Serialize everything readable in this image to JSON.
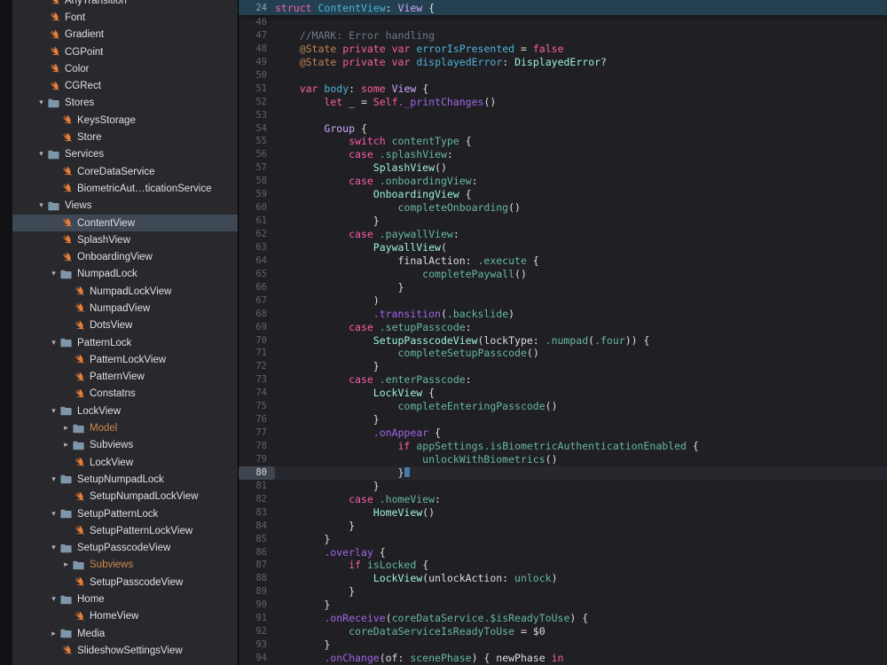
{
  "ui_colors": {
    "sidebar_bg": "#28282d",
    "editor_bg": "#1f1f24",
    "selection_bg": "#3f4855",
    "sticky_header_bg": "#234050",
    "gutter_text": "#60646d",
    "swift_icon": "#e87f38",
    "folder_icon": "#7e96aa",
    "modified_item": "#cc8a4d"
  },
  "sidebar": {
    "selected_label": "ContentView",
    "items": [
      {
        "label": "AnyTransition",
        "icon": "swift",
        "level": 1
      },
      {
        "label": "Font",
        "icon": "swift",
        "level": 1
      },
      {
        "label": "Gradient",
        "icon": "swift",
        "level": 1
      },
      {
        "label": "CGPoint",
        "icon": "swift",
        "level": 1
      },
      {
        "label": "Color",
        "icon": "swift",
        "level": 1
      },
      {
        "label": "CGRect",
        "icon": "swift",
        "level": 1
      },
      {
        "label": "Stores",
        "icon": "folder-open",
        "level": 1
      },
      {
        "label": "KeysStorage",
        "icon": "swift",
        "level": 2
      },
      {
        "label": "Store",
        "icon": "swift",
        "level": 2
      },
      {
        "label": "Services",
        "icon": "folder-open",
        "level": 1
      },
      {
        "label": "CoreDataService",
        "icon": "swift",
        "level": 2
      },
      {
        "label": "BiometricAut…ticationService",
        "icon": "swift",
        "level": 2
      },
      {
        "label": "Views",
        "icon": "folder-open",
        "level": 1
      },
      {
        "label": "ContentView",
        "icon": "swift",
        "level": 2,
        "selected": true
      },
      {
        "label": "SplashView",
        "icon": "swift",
        "level": 2
      },
      {
        "label": "OnboardingView",
        "icon": "swift",
        "level": 2
      },
      {
        "label": "NumpadLock",
        "icon": "folder-open",
        "level": 2
      },
      {
        "label": "NumpadLockView",
        "icon": "swift",
        "level": 3
      },
      {
        "label": "NumpadView",
        "icon": "swift",
        "level": 3
      },
      {
        "label": "DotsView",
        "icon": "swift",
        "level": 3
      },
      {
        "label": "PatternLock",
        "icon": "folder-open",
        "level": 2
      },
      {
        "label": "PatternLockView",
        "icon": "swift",
        "level": 3
      },
      {
        "label": "PatternView",
        "icon": "swift",
        "level": 3
      },
      {
        "label": "Constatns",
        "icon": "swift",
        "level": 3
      },
      {
        "label": "LockView",
        "icon": "folder-open",
        "level": 2
      },
      {
        "label": "Model",
        "icon": "folder-closed",
        "level": 3,
        "color": "#cc8a4d"
      },
      {
        "label": "Subviews",
        "icon": "folder-closed",
        "level": 3
      },
      {
        "label": "LockView",
        "icon": "swift",
        "level": 3
      },
      {
        "label": "SetupNumpadLock",
        "icon": "folder-open",
        "level": 2
      },
      {
        "label": "SetupNumpadLockView",
        "icon": "swift",
        "level": 3
      },
      {
        "label": "SetupPatternLock",
        "icon": "folder-open",
        "level": 2
      },
      {
        "label": "SetupPatternLockView",
        "icon": "swift",
        "level": 3
      },
      {
        "label": "SetupPasscodeView",
        "icon": "folder-open",
        "level": 2
      },
      {
        "label": "Subviews",
        "icon": "folder-closed",
        "level": 3,
        "color": "#cc8a4d"
      },
      {
        "label": "SetupPasscodeView",
        "icon": "swift",
        "level": 3
      },
      {
        "label": "Home",
        "icon": "folder-open",
        "level": 2
      },
      {
        "label": "HomeView",
        "icon": "swift",
        "level": 3
      },
      {
        "label": "Media",
        "icon": "folder-closed",
        "level": 2
      },
      {
        "label": "SlideshowSettingsView",
        "icon": "swift",
        "level": 2
      }
    ]
  },
  "editor": {
    "palette": {
      "p": "#dfdfe0",
      "k": "#fc5fa3",
      "a": "#bf8555",
      "tp": "#9ef1dd",
      "mp": "#67b7a4",
      "to": "#d0a8ff",
      "mo": "#a167e6",
      "c": "#6c7986",
      "d": "#4fb4d8"
    },
    "sticky": {
      "number": "24",
      "tokens": [
        [
          "k",
          "struct"
        ],
        [
          "p",
          " "
        ],
        [
          "d",
          "ContentView"
        ],
        [
          "p",
          ": "
        ],
        [
          "to",
          "View"
        ],
        [
          "p",
          " {"
        ]
      ]
    },
    "current_line": "80",
    "lines": [
      {
        "number": "46",
        "tokens": []
      },
      {
        "number": "47",
        "tokens": [
          [
            "c",
            "    //MARK: Error handling"
          ]
        ]
      },
      {
        "number": "48",
        "tokens": [
          [
            "p",
            "    "
          ],
          [
            "a",
            "@State"
          ],
          [
            "p",
            " "
          ],
          [
            "k",
            "private"
          ],
          [
            "p",
            " "
          ],
          [
            "k",
            "var"
          ],
          [
            "p",
            " "
          ],
          [
            "d",
            "errorIsPresented"
          ],
          [
            "p",
            " = "
          ],
          [
            "k",
            "false"
          ]
        ]
      },
      {
        "number": "49",
        "tokens": [
          [
            "p",
            "    "
          ],
          [
            "a",
            "@State"
          ],
          [
            "p",
            " "
          ],
          [
            "k",
            "private"
          ],
          [
            "p",
            " "
          ],
          [
            "k",
            "var"
          ],
          [
            "p",
            " "
          ],
          [
            "d",
            "displayedError"
          ],
          [
            "p",
            ": "
          ],
          [
            "tp",
            "DisplayedError"
          ],
          [
            "p",
            "?"
          ]
        ]
      },
      {
        "number": "50",
        "tokens": []
      },
      {
        "number": "51",
        "tokens": [
          [
            "p",
            "    "
          ],
          [
            "k",
            "var"
          ],
          [
            "p",
            " "
          ],
          [
            "d",
            "body"
          ],
          [
            "p",
            ": "
          ],
          [
            "k",
            "some"
          ],
          [
            "p",
            " "
          ],
          [
            "to",
            "View"
          ],
          [
            "p",
            " {"
          ]
        ]
      },
      {
        "number": "52",
        "tokens": [
          [
            "p",
            "        "
          ],
          [
            "k",
            "let"
          ],
          [
            "p",
            " _ = "
          ],
          [
            "k",
            "Self"
          ],
          [
            "mo",
            "._printChanges"
          ],
          [
            "p",
            "()"
          ]
        ]
      },
      {
        "number": "53",
        "tokens": []
      },
      {
        "number": "54",
        "tokens": [
          [
            "p",
            "        "
          ],
          [
            "to",
            "Group"
          ],
          [
            "p",
            " {"
          ]
        ]
      },
      {
        "number": "55",
        "tokens": [
          [
            "p",
            "            "
          ],
          [
            "k",
            "switch"
          ],
          [
            "p",
            " "
          ],
          [
            "mp",
            "contentType"
          ],
          [
            "p",
            " {"
          ]
        ]
      },
      {
        "number": "56",
        "tokens": [
          [
            "p",
            "            "
          ],
          [
            "k",
            "case"
          ],
          [
            "p",
            " "
          ],
          [
            "mp",
            ".splashView"
          ],
          [
            "p",
            ":"
          ]
        ]
      },
      {
        "number": "57",
        "tokens": [
          [
            "p",
            "                "
          ],
          [
            "tp",
            "SplashView"
          ],
          [
            "p",
            "()"
          ]
        ]
      },
      {
        "number": "58",
        "tokens": [
          [
            "p",
            "            "
          ],
          [
            "k",
            "case"
          ],
          [
            "p",
            " "
          ],
          [
            "mp",
            ".onboardingView"
          ],
          [
            "p",
            ":"
          ]
        ]
      },
      {
        "number": "59",
        "tokens": [
          [
            "p",
            "                "
          ],
          [
            "tp",
            "OnboardingView"
          ],
          [
            "p",
            " {"
          ]
        ]
      },
      {
        "number": "60",
        "tokens": [
          [
            "p",
            "                    "
          ],
          [
            "mp",
            "completeOnboarding"
          ],
          [
            "p",
            "()"
          ]
        ]
      },
      {
        "number": "61",
        "tokens": [
          [
            "p",
            "                }"
          ]
        ]
      },
      {
        "number": "62",
        "tokens": [
          [
            "p",
            "            "
          ],
          [
            "k",
            "case"
          ],
          [
            "p",
            " "
          ],
          [
            "mp",
            ".paywallView"
          ],
          [
            "p",
            ":"
          ]
        ]
      },
      {
        "number": "63",
        "tokens": [
          [
            "p",
            "                "
          ],
          [
            "tp",
            "PaywallView"
          ],
          [
            "p",
            "("
          ]
        ]
      },
      {
        "number": "64",
        "tokens": [
          [
            "p",
            "                    finalAction: "
          ],
          [
            "mp",
            ".execute"
          ],
          [
            "p",
            " {"
          ]
        ]
      },
      {
        "number": "65",
        "tokens": [
          [
            "p",
            "                        "
          ],
          [
            "mp",
            "completePaywall"
          ],
          [
            "p",
            "()"
          ]
        ]
      },
      {
        "number": "66",
        "tokens": [
          [
            "p",
            "                    }"
          ]
        ]
      },
      {
        "number": "67",
        "tokens": [
          [
            "p",
            "                )"
          ]
        ]
      },
      {
        "number": "68",
        "tokens": [
          [
            "p",
            "                "
          ],
          [
            "mo",
            ".transition"
          ],
          [
            "p",
            "("
          ],
          [
            "mp",
            ".backslide"
          ],
          [
            "p",
            ")"
          ]
        ]
      },
      {
        "number": "69",
        "tokens": [
          [
            "p",
            "            "
          ],
          [
            "k",
            "case"
          ],
          [
            "p",
            " "
          ],
          [
            "mp",
            ".setupPasscode"
          ],
          [
            "p",
            ":"
          ]
        ]
      },
      {
        "number": "70",
        "tokens": [
          [
            "p",
            "                "
          ],
          [
            "tp",
            "SetupPasscodeView"
          ],
          [
            "p",
            "(lockType: "
          ],
          [
            "mp",
            ".numpad"
          ],
          [
            "p",
            "("
          ],
          [
            "mp",
            ".four"
          ],
          [
            "p",
            ")) {"
          ]
        ]
      },
      {
        "number": "71",
        "tokens": [
          [
            "p",
            "                    "
          ],
          [
            "mp",
            "completeSetupPasscode"
          ],
          [
            "p",
            "()"
          ]
        ]
      },
      {
        "number": "72",
        "tokens": [
          [
            "p",
            "                }"
          ]
        ]
      },
      {
        "number": "73",
        "tokens": [
          [
            "p",
            "            "
          ],
          [
            "k",
            "case"
          ],
          [
            "p",
            " "
          ],
          [
            "mp",
            ".enterPasscode"
          ],
          [
            "p",
            ":"
          ]
        ]
      },
      {
        "number": "74",
        "tokens": [
          [
            "p",
            "                "
          ],
          [
            "tp",
            "LockView"
          ],
          [
            "p",
            " {"
          ]
        ]
      },
      {
        "number": "75",
        "tokens": [
          [
            "p",
            "                    "
          ],
          [
            "mp",
            "completeEnteringPasscode"
          ],
          [
            "p",
            "()"
          ]
        ]
      },
      {
        "number": "76",
        "tokens": [
          [
            "p",
            "                }"
          ]
        ]
      },
      {
        "number": "77",
        "tokens": [
          [
            "p",
            "                "
          ],
          [
            "mo",
            ".onAppear"
          ],
          [
            "p",
            " {"
          ]
        ]
      },
      {
        "number": "78",
        "tokens": [
          [
            "p",
            "                    "
          ],
          [
            "k",
            "if"
          ],
          [
            "p",
            " "
          ],
          [
            "mp",
            "appSettings"
          ],
          [
            "mp",
            ".isBiometricAuthenticationEnabled"
          ],
          [
            "p",
            " {"
          ]
        ]
      },
      {
        "number": "79",
        "tokens": [
          [
            "p",
            "                        "
          ],
          [
            "mp",
            "unlockWithBiometrics"
          ],
          [
            "p",
            "()"
          ]
        ]
      },
      {
        "number": "80",
        "tokens": [
          [
            "p",
            "                    }"
          ]
        ],
        "current": true,
        "cursor": true
      },
      {
        "number": "81",
        "tokens": [
          [
            "p",
            "                }"
          ]
        ]
      },
      {
        "number": "82",
        "tokens": [
          [
            "p",
            "            "
          ],
          [
            "k",
            "case"
          ],
          [
            "p",
            " "
          ],
          [
            "mp",
            ".homeView"
          ],
          [
            "p",
            ":"
          ]
        ]
      },
      {
        "number": "83",
        "tokens": [
          [
            "p",
            "                "
          ],
          [
            "tp",
            "HomeView"
          ],
          [
            "p",
            "()"
          ]
        ]
      },
      {
        "number": "84",
        "tokens": [
          [
            "p",
            "            }"
          ]
        ]
      },
      {
        "number": "85",
        "tokens": [
          [
            "p",
            "        }"
          ]
        ]
      },
      {
        "number": "86",
        "tokens": [
          [
            "p",
            "        "
          ],
          [
            "mo",
            ".overlay"
          ],
          [
            "p",
            " {"
          ]
        ]
      },
      {
        "number": "87",
        "tokens": [
          [
            "p",
            "            "
          ],
          [
            "k",
            "if"
          ],
          [
            "p",
            " "
          ],
          [
            "mp",
            "isLocked"
          ],
          [
            "p",
            " {"
          ]
        ]
      },
      {
        "number": "88",
        "tokens": [
          [
            "p",
            "                "
          ],
          [
            "tp",
            "LockView"
          ],
          [
            "p",
            "(unlockAction: "
          ],
          [
            "mp",
            "unlock"
          ],
          [
            "p",
            ")"
          ]
        ]
      },
      {
        "number": "89",
        "tokens": [
          [
            "p",
            "            }"
          ]
        ]
      },
      {
        "number": "90",
        "tokens": [
          [
            "p",
            "        }"
          ]
        ]
      },
      {
        "number": "91",
        "tokens": [
          [
            "p",
            "        "
          ],
          [
            "mo",
            ".onReceive"
          ],
          [
            "p",
            "("
          ],
          [
            "mp",
            "coreDataService"
          ],
          [
            "mp",
            ".$isReadyToUse"
          ],
          [
            "p",
            ") {"
          ]
        ]
      },
      {
        "number": "92",
        "tokens": [
          [
            "p",
            "            "
          ],
          [
            "mp",
            "coreDataServiceIsReadyToUse"
          ],
          [
            "p",
            " = $0"
          ]
        ]
      },
      {
        "number": "93",
        "tokens": [
          [
            "p",
            "        }"
          ]
        ]
      },
      {
        "number": "94",
        "tokens": [
          [
            "p",
            "        "
          ],
          [
            "mo",
            ".onChange"
          ],
          [
            "p",
            "(of: "
          ],
          [
            "mp",
            "scenePhase"
          ],
          [
            "p",
            ") { newPhase "
          ],
          [
            "k",
            "in"
          ]
        ]
      }
    ]
  }
}
